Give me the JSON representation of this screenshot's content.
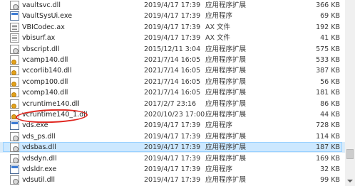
{
  "files": [
    {
      "name": "vaultsvc.dll",
      "date": "2019/4/17 17:39",
      "type": "应用程序扩展",
      "size": "366 KB",
      "icon": "dll-icon"
    },
    {
      "name": "VaultSysUi.exe",
      "date": "2019/4/17 17:39",
      "type": "应用程序",
      "size": "69 KB",
      "icon": "exe-icon"
    },
    {
      "name": "VBICodec.ax",
      "date": "2019/4/17 17:39",
      "type": "AX 文件",
      "size": "192 KB",
      "icon": "ax-icon"
    },
    {
      "name": "vbisurf.ax",
      "date": "2019/4/17 17:39",
      "type": "AX 文件",
      "size": "41 KB",
      "icon": "ax-icon"
    },
    {
      "name": "vbscript.dll",
      "date": "2015/12/11 3:04",
      "type": "应用程序扩展",
      "size": "575 KB",
      "icon": "dll-icon"
    },
    {
      "name": "vcamp140.dll",
      "date": "2021/7/14 16:05",
      "type": "应用程序扩展",
      "size": "533 KB",
      "icon": "gear-dll-icon"
    },
    {
      "name": "vccorlib140.dll",
      "date": "2021/7/14 16:05",
      "type": "应用程序扩展",
      "size": "387 KB",
      "icon": "gear-dll-icon"
    },
    {
      "name": "vcomp100.dll",
      "date": "2021/7/14 16:05",
      "type": "应用程序扩展",
      "size": "56 KB",
      "icon": "gear-dll-icon"
    },
    {
      "name": "vcomp140.dll",
      "date": "2021/7/14 16:05",
      "type": "应用程序扩展",
      "size": "181 KB",
      "icon": "gear-dll-icon"
    },
    {
      "name": "vcruntime140.dll",
      "date": "2017/2/7 23:16",
      "type": "应用程序扩展",
      "size": "86 KB",
      "icon": "gear-dll-icon"
    },
    {
      "name": "vcruntime140_1.dll",
      "date": "2020/10/23 17:00",
      "type": "应用程序扩展",
      "size": "44 KB",
      "icon": "gear-dll-icon"
    },
    {
      "name": "vds.exe",
      "date": "2019/4/17 17:39",
      "type": "应用程序",
      "size": "728 KB",
      "icon": "exe-icon"
    },
    {
      "name": "vds_ps.dll",
      "date": "2019/4/17 17:39",
      "type": "应用程序扩展",
      "size": "114 KB",
      "icon": "dll-icon"
    },
    {
      "name": "vdsbas.dll",
      "date": "2019/4/17 17:39",
      "type": "应用程序扩展",
      "size": "187 KB",
      "icon": "dll-icon",
      "selected": true
    },
    {
      "name": "vdsdyn.dll",
      "date": "2019/4/17 17:39",
      "type": "应用程序扩展",
      "size": "169 KB",
      "icon": "dll-icon"
    },
    {
      "name": "vdsldr.exe",
      "date": "2019/4/17 17:39",
      "type": "应用程序",
      "size": "32 KB",
      "icon": "exe-icon"
    },
    {
      "name": "vdsutil.dll",
      "date": "2019/4/17 17:39",
      "type": "应用程序扩展",
      "size": "99 KB",
      "icon": "dll-icon"
    }
  ],
  "colors": {
    "annotation": "#e0261f",
    "selection": "#cce8ff"
  }
}
